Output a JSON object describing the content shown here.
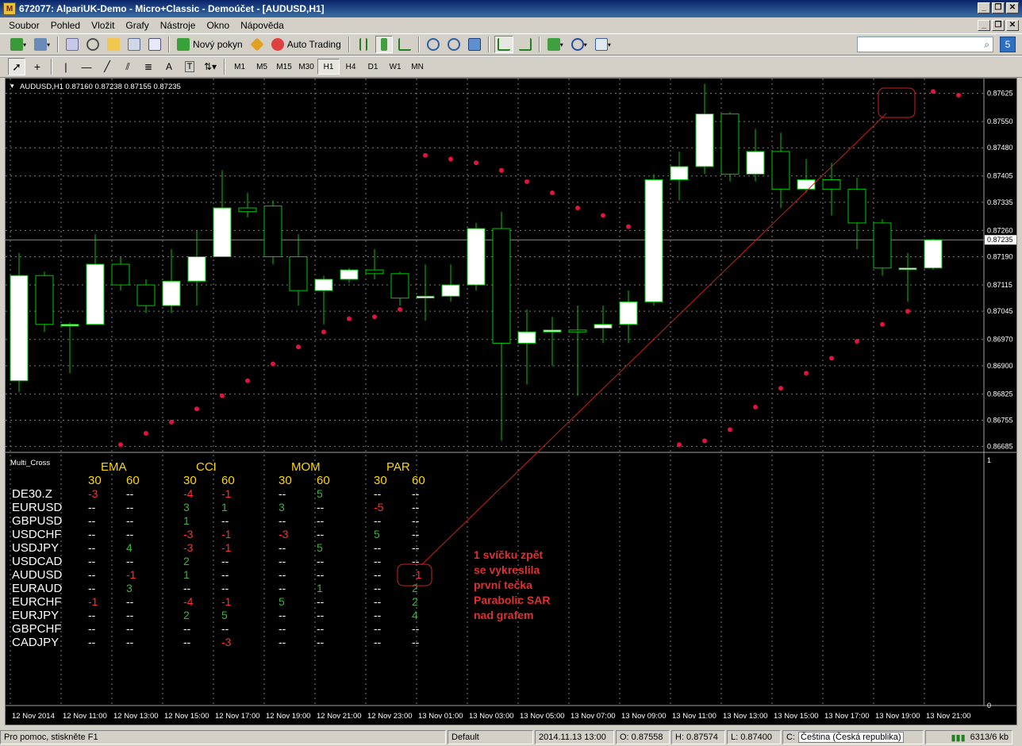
{
  "window": {
    "title": "672077: AlpariUK-Demo - Micro+Classic - Demoúčet - [AUDUSD,H1]",
    "minimize": "_",
    "restore": "❐",
    "close": "✕"
  },
  "menu": {
    "items": [
      "Soubor",
      "Pohled",
      "Vložit",
      "Grafy",
      "Nástroje",
      "Okno",
      "Nápověda"
    ]
  },
  "toolbar1": {
    "new_order_label": "Nový pokyn",
    "auto_trading_label": "Auto Trading",
    "search_count": "5"
  },
  "toolbar2": {
    "timeframes": [
      "M1",
      "M5",
      "M15",
      "M30",
      "H1",
      "H4",
      "D1",
      "W1",
      "MN"
    ],
    "active_timeframe": "H1"
  },
  "chart": {
    "header": "AUDUSD,H1  0.87160 0.87238 0.87155 0.87235",
    "current_price": "0.87235",
    "indicator_name": "Multi_Cross",
    "indicator_scale_top": "1",
    "indicator_scale_bottom": "0",
    "price_labels": [
      "0.87625",
      "0.87550",
      "0.87480",
      "0.87405",
      "0.87335",
      "0.87260",
      "0.87190",
      "0.87115",
      "0.87045",
      "0.86970",
      "0.86900",
      "0.86825",
      "0.86755",
      "0.86685"
    ],
    "time_labels": [
      "12 Nov 2014",
      "12 Nov 11:00",
      "12 Nov 13:00",
      "12 Nov 15:00",
      "12 Nov 17:00",
      "12 Nov 19:00",
      "12 Nov 21:00",
      "12 Nov 23:00",
      "13 Nov 01:00",
      "13 Nov 03:00",
      "13 Nov 05:00",
      "13 Nov 07:00",
      "13 Nov 09:00",
      "13 Nov 11:00",
      "13 Nov 13:00",
      "13 Nov 15:00",
      "13 Nov 17:00",
      "13 Nov 19:00",
      "13 Nov 21:00"
    ],
    "colors": {
      "background": "#000000",
      "bull_body": "#ffffff",
      "wick": "#00c800",
      "sar_dot": "#e0143c",
      "annotation": "#e03030",
      "grid": "#7a7a7a"
    }
  },
  "chart_data": {
    "type": "candlestick",
    "symbol": "AUDUSD",
    "timeframe": "H1",
    "ylim": [
      0.8668,
      0.8766
    ],
    "candles": [
      {
        "o": 0.8686,
        "h": 0.872,
        "l": 0.8683,
        "c": 0.8714
      },
      {
        "o": 0.8714,
        "h": 0.8715,
        "l": 0.8699,
        "c": 0.8701
      },
      {
        "o": 0.8701,
        "h": 0.87015,
        "l": 0.8688,
        "c": 0.8701
      },
      {
        "o": 0.8701,
        "h": 0.8725,
        "l": 0.8701,
        "c": 0.8717
      },
      {
        "o": 0.8717,
        "h": 0.8719,
        "l": 0.871,
        "c": 0.87115
      },
      {
        "o": 0.87115,
        "h": 0.8713,
        "l": 0.8704,
        "c": 0.8706
      },
      {
        "o": 0.8706,
        "h": 0.8721,
        "l": 0.8704,
        "c": 0.87125
      },
      {
        "o": 0.87125,
        "h": 0.8726,
        "l": 0.8706,
        "c": 0.8719
      },
      {
        "o": 0.8719,
        "h": 0.8742,
        "l": 0.8719,
        "c": 0.8732
      },
      {
        "o": 0.8732,
        "h": 0.8736,
        "l": 0.87295,
        "c": 0.8731
      },
      {
        "o": 0.87325,
        "h": 0.8734,
        "l": 0.8717,
        "c": 0.8719
      },
      {
        "o": 0.8719,
        "h": 0.8725,
        "l": 0.8706,
        "c": 0.871
      },
      {
        "o": 0.871,
        "h": 0.8714,
        "l": 0.8701,
        "c": 0.8713
      },
      {
        "o": 0.8713,
        "h": 0.8716,
        "l": 0.8712,
        "c": 0.87155
      },
      {
        "o": 0.87155,
        "h": 0.8721,
        "l": 0.8713,
        "c": 0.87145
      },
      {
        "o": 0.87145,
        "h": 0.8715,
        "l": 0.8706,
        "c": 0.8708
      },
      {
        "o": 0.8708,
        "h": 0.8717,
        "l": 0.8702,
        "c": 0.87085
      },
      {
        "o": 0.87085,
        "h": 0.8717,
        "l": 0.8707,
        "c": 0.87115
      },
      {
        "o": 0.87115,
        "h": 0.8728,
        "l": 0.871,
        "c": 0.87265
      },
      {
        "o": 0.87265,
        "h": 0.8731,
        "l": 0.867,
        "c": 0.8696
      },
      {
        "o": 0.8696,
        "h": 0.8705,
        "l": 0.8685,
        "c": 0.8699
      },
      {
        "o": 0.8699,
        "h": 0.8703,
        "l": 0.869,
        "c": 0.86995
      },
      {
        "o": 0.86995,
        "h": 0.8706,
        "l": 0.8682,
        "c": 0.8699
      },
      {
        "o": 0.87,
        "h": 0.8706,
        "l": 0.8696,
        "c": 0.8701
      },
      {
        "o": 0.8701,
        "h": 0.871,
        "l": 0.8696,
        "c": 0.8707
      },
      {
        "o": 0.8707,
        "h": 0.8741,
        "l": 0.8706,
        "c": 0.87395
      },
      {
        "o": 0.87395,
        "h": 0.8747,
        "l": 0.8734,
        "c": 0.8743
      },
      {
        "o": 0.8743,
        "h": 0.8765,
        "l": 0.8741,
        "c": 0.8757
      },
      {
        "o": 0.8757,
        "h": 0.87575,
        "l": 0.8739,
        "c": 0.8741
      },
      {
        "o": 0.8741,
        "h": 0.8753,
        "l": 0.8739,
        "c": 0.8747
      },
      {
        "o": 0.8747,
        "h": 0.8752,
        "l": 0.8732,
        "c": 0.8737
      },
      {
        "o": 0.8737,
        "h": 0.8745,
        "l": 0.8736,
        "c": 0.87395
      },
      {
        "o": 0.87395,
        "h": 0.8744,
        "l": 0.873,
        "c": 0.8737
      },
      {
        "o": 0.8737,
        "h": 0.874,
        "l": 0.8721,
        "c": 0.8728
      },
      {
        "o": 0.8728,
        "h": 0.8729,
        "l": 0.8714,
        "c": 0.8716
      },
      {
        "o": 0.8716,
        "h": 0.872,
        "l": 0.8707,
        "c": 0.8716
      },
      {
        "o": 0.8716,
        "h": 0.87238,
        "l": 0.87155,
        "c": 0.87235
      }
    ],
    "sar": [
      null,
      null,
      null,
      null,
      0.8669,
      0.8672,
      0.8675,
      0.86785,
      0.8682,
      0.8686,
      0.86905,
      0.8695,
      0.8699,
      0.87025,
      0.8703,
      0.8705,
      0.8746,
      0.8745,
      0.8744,
      0.8742,
      0.8739,
      0.8736,
      0.8732,
      0.873,
      0.8727,
      null,
      0.8669,
      0.867,
      0.8673,
      0.8679,
      0.8684,
      0.8688,
      0.8692,
      0.86965,
      0.8701,
      0.87045,
      0.8763,
      0.8762
    ]
  },
  "indicator_table": {
    "groups": [
      "EMA",
      "CCI",
      "MOM",
      "PAR"
    ],
    "periods": [
      "30",
      "60"
    ],
    "rows": [
      {
        "symbol": "DE30.Z",
        "values": [
          "-3",
          "--",
          "-4",
          "-1",
          "--",
          "5",
          "--",
          "--"
        ]
      },
      {
        "symbol": "EURUSD",
        "values": [
          "--",
          "--",
          "3",
          "1",
          "3",
          "--",
          "-5",
          "--"
        ]
      },
      {
        "symbol": "GBPUSD",
        "values": [
          "--",
          "--",
          "1",
          "--",
          "--",
          "--",
          "--",
          "--"
        ]
      },
      {
        "symbol": "USDCHF",
        "values": [
          "--",
          "--",
          "-3",
          "-1",
          "-3",
          "--",
          "5",
          "--"
        ]
      },
      {
        "symbol": "USDJPY",
        "values": [
          "--",
          "4",
          "-3",
          "-1",
          "--",
          "5",
          "--",
          "--"
        ]
      },
      {
        "symbol": "USDCAD",
        "values": [
          "--",
          "--",
          "2",
          "--",
          "--",
          "--",
          "--",
          "--"
        ]
      },
      {
        "symbol": "AUDUSD",
        "values": [
          "--",
          "-1",
          "1",
          "--",
          "--",
          "--",
          "--",
          "-1"
        ]
      },
      {
        "symbol": "EURAUD",
        "values": [
          "--",
          "3",
          "--",
          "--",
          "--",
          "1",
          "--",
          "2"
        ]
      },
      {
        "symbol": "EURCHF",
        "values": [
          "-1",
          "--",
          "-4",
          "-1",
          "5",
          "--",
          "--",
          "2"
        ]
      },
      {
        "symbol": "EURJPY",
        "values": [
          "--",
          "--",
          "2",
          "5",
          "--",
          "--",
          "--",
          "4"
        ]
      },
      {
        "symbol": "GBPCHF",
        "values": [
          "--",
          "--",
          "--",
          "--",
          "--",
          "--",
          "--",
          "--"
        ]
      },
      {
        "symbol": "CADJPY",
        "values": [
          "--",
          "--",
          "--",
          "-3",
          "--",
          "--",
          "--",
          "--"
        ]
      }
    ],
    "colors": {
      "header": "#ffd700",
      "symbol": "#ffffff",
      "positive": "#3cb43c",
      "negative": "#ff3030",
      "neutral": "#ffffff"
    }
  },
  "annotation": {
    "lines": [
      "1 svíčku zpět",
      "se vykreslila",
      "první tečka",
      "Parabolic SAR",
      "nad grafem"
    ]
  },
  "status": {
    "help": "Pro pomoc, stiskněte F1",
    "profile": "Default",
    "datetime": "2014.11.13 13:00",
    "open": "O: 0.87558",
    "high": "H: 0.87574",
    "low": "L: 0.87400",
    "close_label": "C:",
    "language": "Čeština (Česká republika)",
    "traffic": "6313/6 kb"
  }
}
